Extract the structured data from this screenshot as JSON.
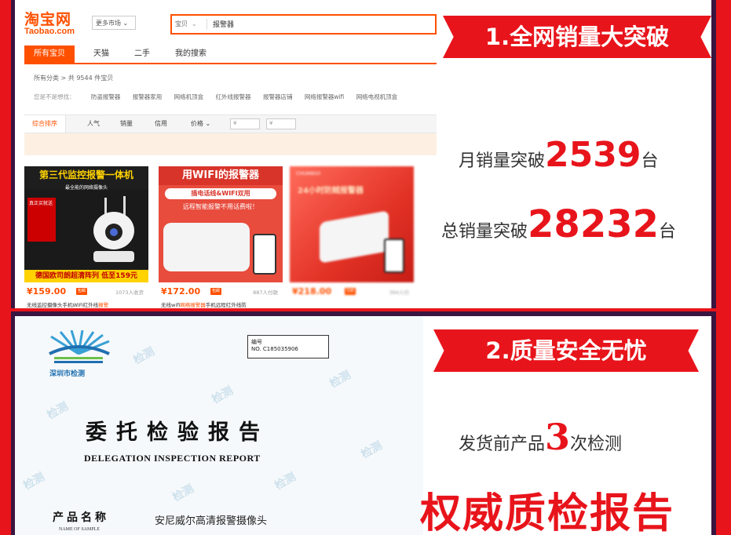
{
  "colors": {
    "accent_red": "#e8141b",
    "taobao_orange": "#ff5000",
    "frame_dark": "#3a1540"
  },
  "taobao": {
    "logo_cn": "淘宝网",
    "logo_en": "Taobao.com",
    "market_select": "更多市场 ⌄",
    "search_type": "宝贝",
    "search_query": "报警器",
    "tabs": [
      "所有宝贝",
      "天猫",
      "二手",
      "我的搜索"
    ],
    "breadcrumb": "所有分类 > 共 9544 件宝贝",
    "related_label": "您是不是想找：",
    "related": [
      "防盗报警器",
      "报警器家用",
      "网络机顶盒",
      "红外线报警器",
      "报警器店铺",
      "网络报警器wifi",
      "网络电视机顶盒"
    ],
    "sort": [
      "综合排序",
      "人气",
      "销量",
      "信用",
      "价格 ⌄"
    ],
    "price_from": "¥",
    "price_to": "¥",
    "products": [
      {
        "price": "¥159.00",
        "badge": "包邮",
        "sold": "1073人收货",
        "title_pre": "无线监控摄像头手机WiFi红外线",
        "title_hl": "报警",
        "art_head": "第三代监控报警一体机",
        "art_sub": "最全能的网络摄像头",
        "art_foot": "德国欧司朗超清阵列 低至159元",
        "art_side": "真正买就送"
      },
      {
        "price": "¥172.00",
        "badge": "包邮",
        "sold": "887人付款",
        "title_pre": "无线wifi",
        "title_hl": "网络报警器",
        "title_post": "手机远程红外线防",
        "art_head": "用WIFI的报警器",
        "art_band": "插电话线&WIFI双用",
        "art_band2": "远程智能报警不用话费啦！"
      },
      {
        "price": "¥218.00",
        "badge": "包邮",
        "sold": "394人付",
        "title_pre": "",
        "title_hl": "",
        "art_brand": "CHUANGO",
        "art_head": "24小时防贼报警器"
      }
    ]
  },
  "sales": {
    "ribbon": "1.全网销量大突破",
    "monthly_label": "月销量突破",
    "monthly_value": "2539",
    "monthly_unit": "台",
    "total_label": "总销量突破",
    "total_value": "28232",
    "total_unit": "台"
  },
  "certificate": {
    "logo_text": "深圳市检测",
    "number_label": "编号",
    "number": "NO. C185035906",
    "title_cn": "委托检验报告",
    "title_en": "DELEGATION INSPECTION REPORT",
    "field_label": "产品名称",
    "field_label_en": "NAME OF SAMPLE",
    "field_value": "安尼威尔高清报警摄像头",
    "watermark": "检测"
  },
  "quality": {
    "ribbon": "2.质量安全无忧",
    "check_pre": "发货前产品",
    "check_value": "3",
    "check_post": "次检测",
    "authority": "权威质检报告"
  }
}
